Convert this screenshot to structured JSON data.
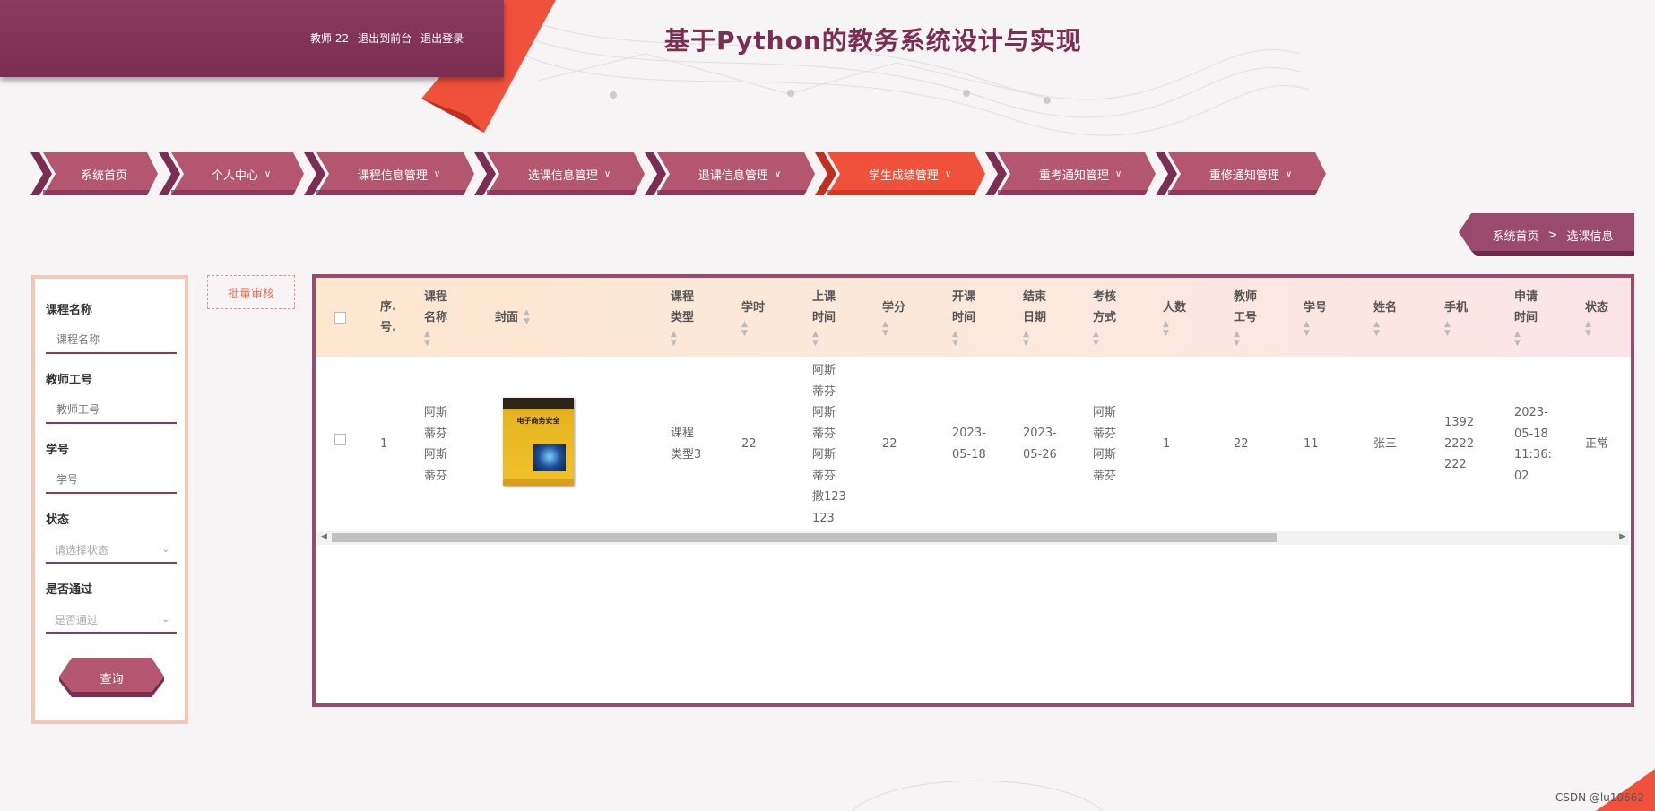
{
  "header": {
    "user": "教师 22",
    "to_front": "退出到前台",
    "logout": "退出登录",
    "title": "基于Python的教务系统设计与实现"
  },
  "nav": [
    {
      "label": "系统首页",
      "dropdown": false,
      "active": false
    },
    {
      "label": "个人中心",
      "dropdown": true,
      "active": false
    },
    {
      "label": "课程信息管理",
      "dropdown": true,
      "active": false
    },
    {
      "label": "选课信息管理",
      "dropdown": true,
      "active": false
    },
    {
      "label": "退课信息管理",
      "dropdown": true,
      "active": false
    },
    {
      "label": "学生成绩管理",
      "dropdown": true,
      "active": true
    },
    {
      "label": "重考通知管理",
      "dropdown": true,
      "active": false
    },
    {
      "label": "重修通知管理",
      "dropdown": true,
      "active": false
    }
  ],
  "breadcrumb": {
    "home": "系统首页",
    "sep": ">",
    "current": "选课信息"
  },
  "filter": {
    "course_name_label": "课程名称",
    "course_name_placeholder": "课程名称",
    "teacher_id_label": "教师工号",
    "teacher_id_placeholder": "教师工号",
    "student_id_label": "学号",
    "student_id_placeholder": "学号",
    "status_label": "状态",
    "status_placeholder": "请选择状态",
    "passed_label": "是否通过",
    "passed_placeholder": "是否通过",
    "query_button": "查询"
  },
  "batch_review": "批量审核",
  "table": {
    "headers": {
      "seq": [
        "序.",
        "号."
      ],
      "course_name": [
        "课程",
        "名称"
      ],
      "cover": "封面",
      "course_type": [
        "课程",
        "类型"
      ],
      "hours": "学时",
      "class_time": [
        "上课",
        "时间"
      ],
      "credits": "学分",
      "start": [
        "开课",
        "时间"
      ],
      "end": [
        "结束",
        "日期"
      ],
      "exam": [
        "考核",
        "方式"
      ],
      "count": "人数",
      "teacher_id": [
        "教师",
        "工号"
      ],
      "student_id": "学号",
      "name": "姓名",
      "phone": "手机",
      "apply_time": [
        "申请",
        "时间"
      ],
      "status": "状态"
    },
    "row": {
      "seq": "1",
      "course_name": [
        "阿斯",
        "蒂芬",
        "阿斯",
        "蒂芬"
      ],
      "cover_title": "电子商务安全",
      "course_type": [
        "课程",
        "类型3"
      ],
      "hours": "22",
      "class_time": [
        "阿斯",
        "蒂芬",
        "阿斯",
        "蒂芬",
        "阿斯",
        "蒂芬",
        "撒123",
        "123"
      ],
      "credits": "22",
      "start": [
        "2023-",
        "05-18"
      ],
      "end": [
        "2023-",
        "05-26"
      ],
      "exam": [
        "阿斯",
        "蒂芬",
        "阿斯",
        "蒂芬"
      ],
      "count": "1",
      "teacher_id": "22",
      "student_id": "11",
      "name": "张三",
      "phone": [
        "1392",
        "2222",
        "222"
      ],
      "apply_time": [
        "2023-",
        "05-18",
        "11:36:",
        "02"
      ],
      "status": "正常"
    }
  },
  "watermark": "CSDN @lu10662",
  "colors": {
    "primary": "#8a3a5f",
    "nav": "#b4566f",
    "active": "#f0513a",
    "accent": "#e0735a"
  }
}
